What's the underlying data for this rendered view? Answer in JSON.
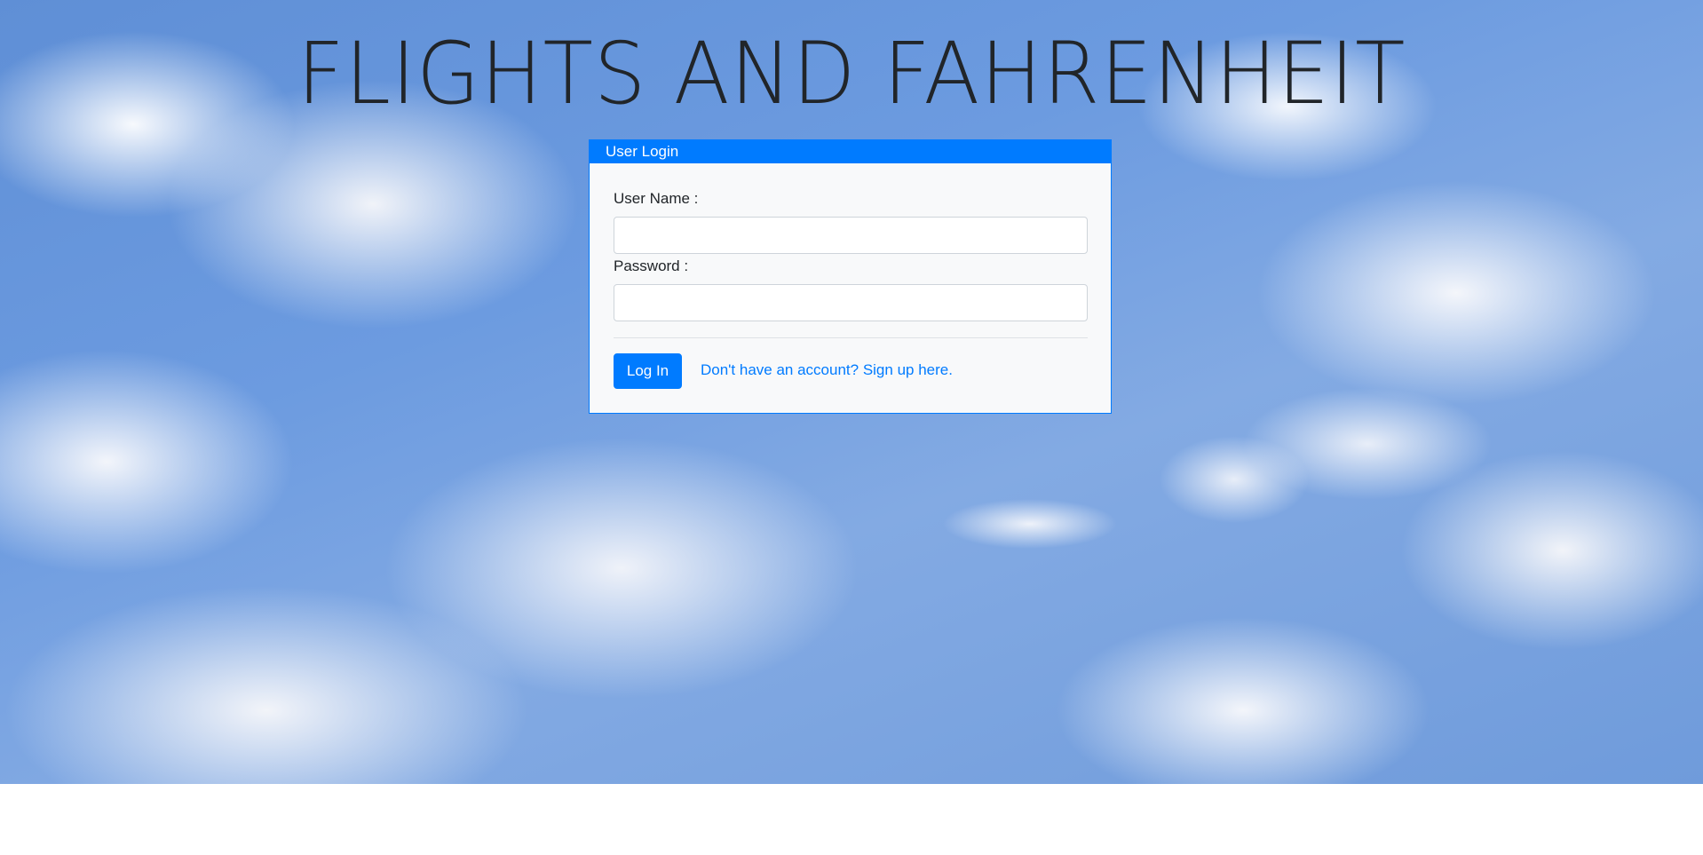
{
  "page": {
    "title": "FLIGHTS AND FAHRENHEIT"
  },
  "login_card": {
    "header": "User Login",
    "username_label": "User Name :",
    "username_value": "",
    "password_label": "Password :",
    "password_value": "",
    "login_button": "Log In",
    "signup_link": "Don't have an account? Sign up here."
  },
  "colors": {
    "primary": "#007bff",
    "card_background": "#f8f9fa",
    "title_text": "#212529"
  }
}
